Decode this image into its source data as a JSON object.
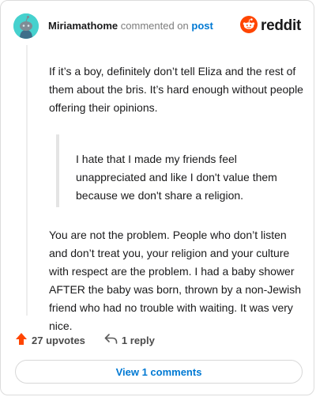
{
  "comment": {
    "username": "Miriamathome",
    "action_text": "commented on",
    "post_link_text": "post",
    "paragraph_1": "If it’s a boy, definitely don’t tell Eliza and the rest of them about the bris. It’s hard enough without people offering their opinions.",
    "quote": "I hate that I made my friends feel unappreciated and like I don't value them because we don't share a religion.",
    "paragraph_2": "You are not the problem. People who don’t listen and don’t treat you, your religion and your culture with respect are the problem. I had a baby shower AFTER the baby was born, thrown by a non-Jewish friend who had no trouble with waiting. It was very nice."
  },
  "brand": {
    "name": "reddit",
    "icon": "reddit-snoo-icon",
    "color": "#ff4500"
  },
  "avatar": {
    "icon": "snoo-avatar-icon",
    "bg_color": "#46d1ce"
  },
  "actions": {
    "upvotes_label": "27 upvotes",
    "upvote_icon": "upvote-arrow-icon",
    "upvote_color": "#ff4500",
    "reply_label": "1 reply",
    "reply_icon": "reply-arrow-icon"
  },
  "view_comments_label": "View 1 comments",
  "link_color": "#0079d3"
}
